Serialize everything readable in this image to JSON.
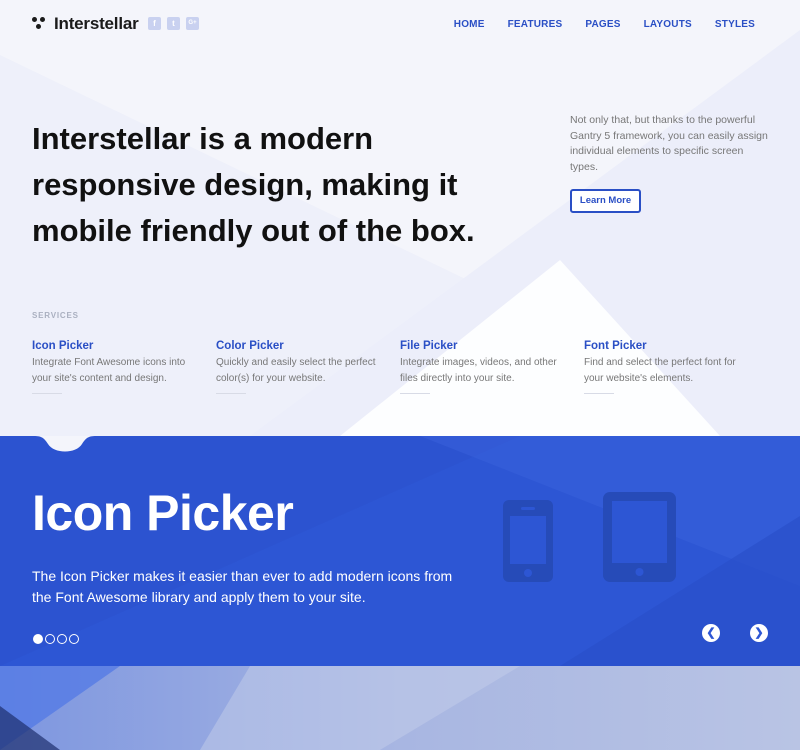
{
  "brand": {
    "name": "Interstellar"
  },
  "social": [
    {
      "icon": "facebook-icon",
      "glyph": "f"
    },
    {
      "icon": "twitter-icon",
      "glyph": "t"
    },
    {
      "icon": "google-plus-icon",
      "glyph": "G+"
    }
  ],
  "nav": [
    "HOME",
    "FEATURES",
    "PAGES",
    "LAYOUTS",
    "STYLES"
  ],
  "hero": {
    "heading": "Interstellar is a modern responsive design, making it mobile friendly out of the box.",
    "side_text": "Not only that, but thanks to the powerful Gantry 5 framework, you can easily assign individual elements to specific screen types.",
    "button": "Learn More"
  },
  "services": {
    "label": "SERVICES",
    "items": [
      {
        "title": "Icon Picker",
        "desc": "Integrate Font Awesome icons into your site's content and design."
      },
      {
        "title": "Color Picker",
        "desc": "Quickly and easily select the perfect color(s) for your website."
      },
      {
        "title": "File Picker",
        "desc": "Integrate images, videos, and other files directly into your site."
      },
      {
        "title": "Font Picker",
        "desc": "Find and select the perfect font for your website's elements."
      }
    ]
  },
  "slider": {
    "title": "Icon Picker",
    "text": "The Icon Picker makes it easier than ever to add modern icons from the Font Awesome library and apply them to your site.",
    "slide_count": 4,
    "active_slide": 1,
    "prev_glyph": "❮",
    "next_glyph": "❯"
  },
  "colors": {
    "accent": "#2a4fc5",
    "slider_bg": "#2d56d4",
    "page_bg": "#f4f5fb"
  }
}
